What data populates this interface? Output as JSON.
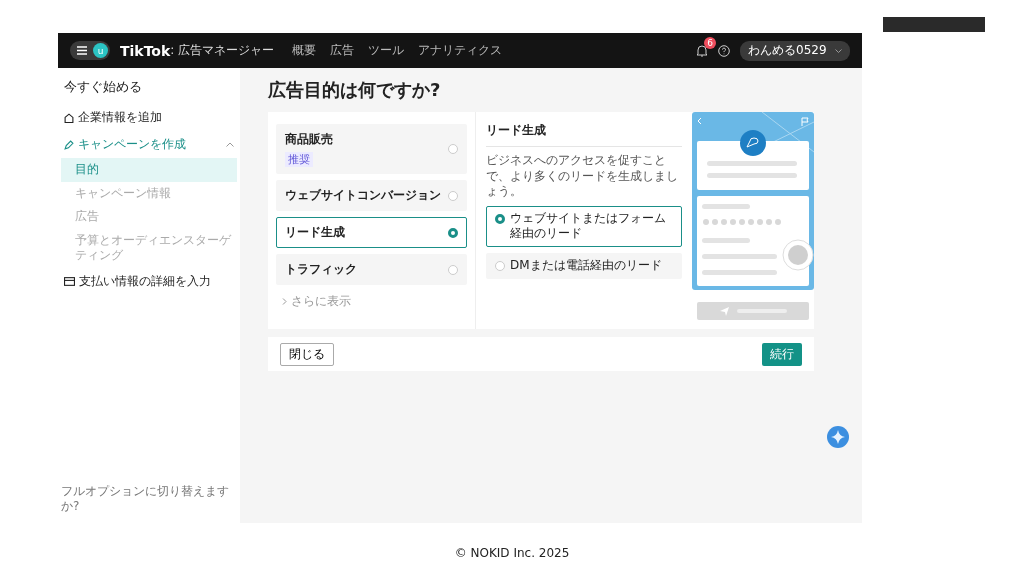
{
  "header": {
    "avatar": "u",
    "logo": "TikTok",
    "product": ": 広告マネージャー",
    "nav": [
      {
        "label": "概要"
      },
      {
        "label": "広告"
      },
      {
        "label": "ツール"
      },
      {
        "label": "アナリティクス"
      }
    ],
    "notification_count": "6",
    "account": "わんめる0529"
  },
  "sidebar": {
    "title": "今すぐ始める",
    "sections": [
      {
        "label": "企業情報を追加",
        "expanded": false
      },
      {
        "label": "キャンペーンを作成",
        "expanded": true,
        "children": [
          {
            "label": "目的",
            "selected": true
          },
          {
            "label": "キャンペーン情報",
            "selected": false
          },
          {
            "label": "広告",
            "selected": false
          },
          {
            "label": "予算とオーディエンスターゲティング",
            "selected": false
          }
        ]
      },
      {
        "label": "支払い情報の詳細を入力",
        "expanded": false
      }
    ],
    "footer_link": "フルオプションに切り替えますか?"
  },
  "page_title": "広告目的は何ですか?",
  "objectives": [
    {
      "label": "商品販売",
      "badge": "推奨",
      "selected": false
    },
    {
      "label": "ウェブサイトコンバージョン",
      "selected": false
    },
    {
      "label": "リード生成",
      "selected": true
    },
    {
      "label": "トラフィック",
      "selected": false
    }
  ],
  "show_more": "さらに表示",
  "detail": {
    "title": "リード生成",
    "description": "ビジネスへのアクセスを促すことで、より多くのリードを生成しましょう。",
    "options": [
      {
        "label": "ウェブサイトまたはフォーム経由のリード",
        "selected": true
      },
      {
        "label": "DMまたは電話経由のリード",
        "selected": false
      }
    ]
  },
  "buttons": {
    "close": "閉じる",
    "continue": "続行"
  },
  "copyright": "© NOKID Inc. 2025"
}
